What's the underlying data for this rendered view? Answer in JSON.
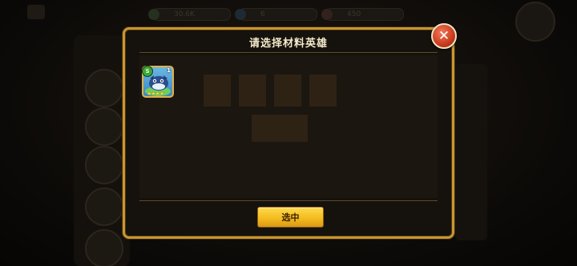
{
  "background": {
    "resources": [
      "30.6K",
      "6",
      "450"
    ]
  },
  "dialog": {
    "title": "请选择材料英雄",
    "close_icon": "close-x-icon",
    "confirm_label": "选中",
    "accent_color": "#c9962e",
    "button_color": "#f2b91c"
  },
  "heroes": [
    {
      "level": "1",
      "element_icon": "nature-element-icon",
      "element_glyph": "S",
      "stars": "★★★★",
      "star_count": 4
    }
  ]
}
